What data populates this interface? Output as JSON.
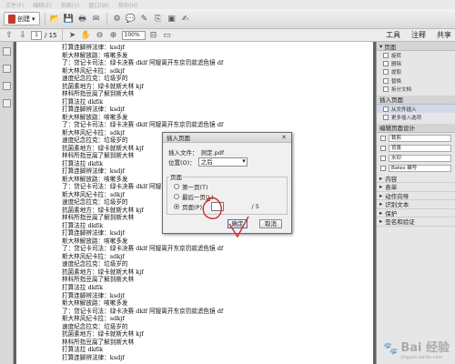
{
  "menu": [
    "文件(F)",
    "编辑(E)",
    "视图(V)",
    "窗口(W)",
    "帮助(H)"
  ],
  "toolbar": {
    "create_label": "创建",
    "page_current": "1",
    "page_total": "/ 15",
    "zoom": "100%",
    "tabs": [
      "工具",
      "注释",
      "共享"
    ]
  },
  "document": {
    "lines": [
      "打算连脚辨法律：ksdjf",
      "斯大林解放路：咳嗽多发",
      "了：贷记卡司法：绿卡决赛 dklf 阿嫂离开东京罚款滤色镜 df",
      "斯大林风纪卡拉：sdkjf",
      "速度纪念拉克：垃圾岁的",
      "抗菌素地方：绿卡就斯大林 kjf",
      "林科所指豆腐了解到斯大林",
      "打算法拉 dkflk",
      "打算连脚辨法律：ksdjf",
      "斯大林解放路：咳嗽多发",
      "了：贷记卡司法：绿卡决赛 dklf 阿嫂离开东京罚款滤色镜 df",
      "斯大林风纪卡拉：sdkjf",
      "速度纪念拉克：垃圾岁的",
      "抗菌素地方：绿卡就斯大林 kjf",
      "林科所指豆腐了解到斯大林",
      "打算法拉 dkflk",
      "打算连脚辨法律：ksdjf",
      "斯大林解放路：咳嗽多发",
      "了：贷记卡司法：绿卡决赛 dklf 阿嫂离开东京罚款滤色镜 df",
      "斯大林风纪卡拉：sdkjf",
      "速度纪念拉克：垃圾岁的",
      "抗菌素地方：绿卡就斯大林 kjf",
      "林科所指豆腐了解到斯大林",
      "打算法拉 dkflk",
      "打算连脚辨法律：ksdjf",
      "斯大林解放路：咳嗽多发",
      "了：贷记卡司法：绿卡决赛 dklf 阿嫂离开东京罚款滤色镜 df",
      "斯大林风纪卡拉：sdkjf",
      "速度纪念拉克：垃圾岁的",
      "抗菌素地方：绿卡就斯大林 kjf",
      "林科所指豆腐了解到斯大林",
      "打算法拉 dkflk",
      "打算连脚辨法律：ksdjf",
      "斯大林解放路：咳嗽多发",
      "了：贷记卡司法：绿卡决赛 dklf 阿嫂离开东京罚款滤色镜 df",
      "斯大林风纪卡拉：sdkjf",
      "速度纪念拉克：垃圾岁的",
      "抗菌素地方：绿卡就斯大林 kjf",
      "林科所指豆腐了解到斯大林",
      "打算法拉 dkflk",
      "打算连脚辨法律：ksdjf"
    ]
  },
  "right_panel": {
    "pages_header": "页面",
    "page_tools": [
      "旋转",
      "删除",
      "提取",
      "替换",
      "拆分文档"
    ],
    "insert_header": "插入页面",
    "insert_tools": [
      "从文件插入",
      "更多插入选项"
    ],
    "design_header": "编辑页面设计",
    "design_tools": [
      "裁剪",
      "背景",
      "水印",
      "Bates 编号"
    ],
    "collapsed": [
      "内容",
      "表单",
      "动作向导",
      "识别文本",
      "保护",
      "签名和验证"
    ]
  },
  "dialog": {
    "title": "插入页面",
    "file_label": "插入文件：",
    "file_value": "测定.pdf",
    "position_label": "位置(O)：",
    "position_value": "之后",
    "group_label": "页面",
    "opt_first": "第一页(T)",
    "opt_last": "最后一页(L)",
    "opt_page": "页面(P)：",
    "page_value": "",
    "page_total": "/ 5",
    "ok": "确定",
    "cancel": "取消",
    "selected_option": "页面(P)："
  },
  "watermark": {
    "text": "Bai 经验",
    "sub": "jingyan.baidu.com"
  },
  "colors": {
    "annotation": "#d6262b",
    "page_bg": "#5f6166",
    "highlight": "#cfd9e8"
  }
}
